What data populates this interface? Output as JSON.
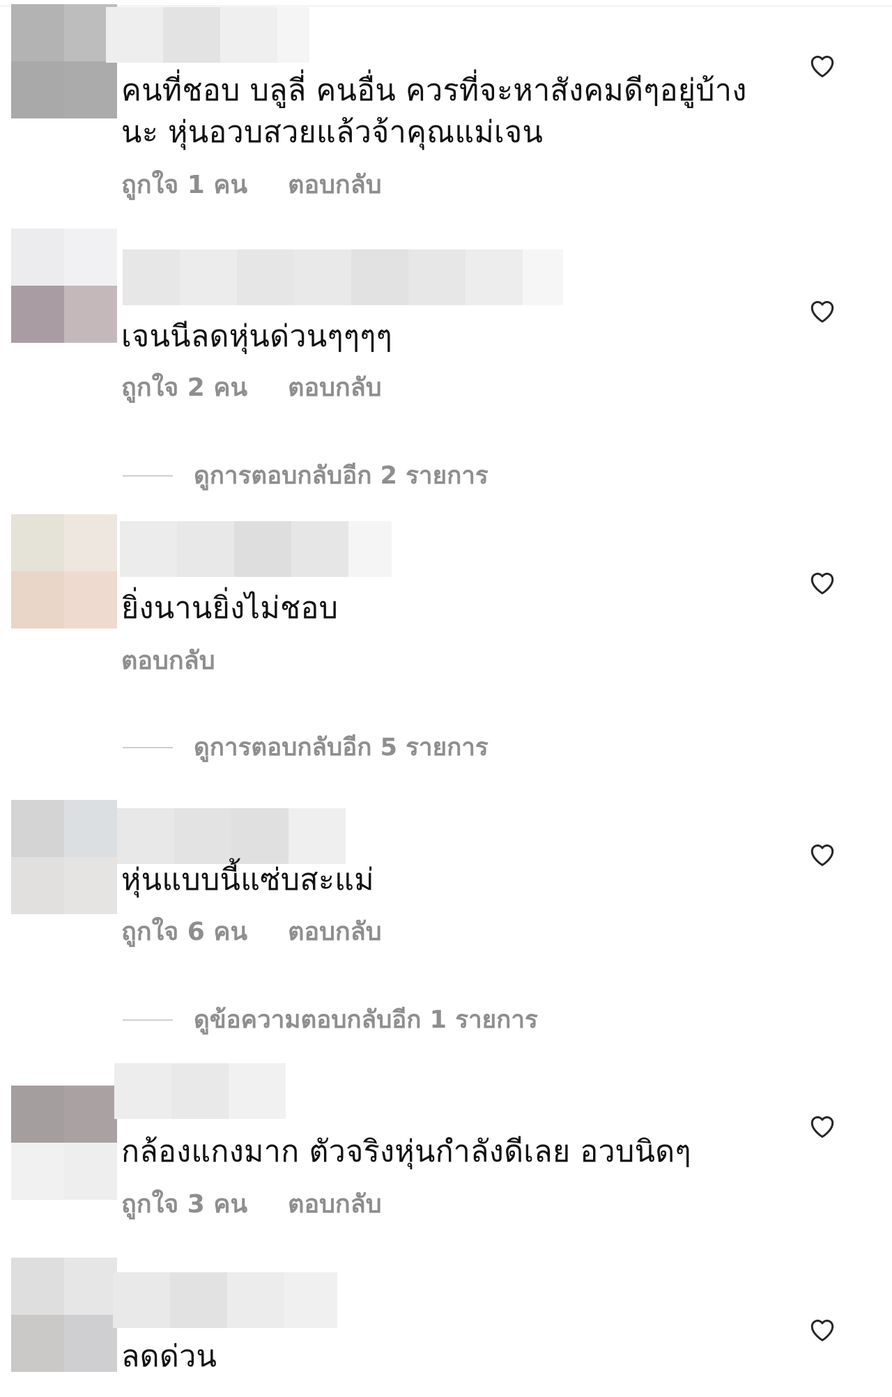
{
  "comments": [
    {
      "text": "คนที่ชอบ บลูลี่ คนอื่น ควรที่จะหาสังคมดีๆอยู่บ้าง\nนะ หุ่นอวบสวยแล้วจ้าคุณแม่เจน",
      "likes": "ถูกใจ 1 คน",
      "reply": "ตอบกลับ",
      "avatar_colors": [
        "#b3b3b3",
        "#bdbdbd",
        "#a9a9a9",
        "#ababab"
      ],
      "name_colors": [
        "#eeeeee",
        "#e3e3e3",
        "#efefef",
        "#f5f5f5"
      ]
    },
    {
      "text": "เจนนีลดหุ่นด่วนๆๆๆๆ",
      "likes": "ถูกใจ 2 คน",
      "reply": "ตอบกลับ",
      "avatar_colors": [
        "#ececee",
        "#f1f1f3",
        "#a99da3",
        "#c5b8bb"
      ],
      "name_colors": [
        "#e7e7e7",
        "#ececec",
        "#e6e6e6",
        "#e9e9e9",
        "#e2e2e2",
        "#e7e7e7",
        "#ededed",
        "#f6f6f6"
      ],
      "view_more": "ดูการตอบกลับอีก 2 รายการ"
    },
    {
      "text": "ยิ่งนานยิ่งไม่ชอบ",
      "likes": "",
      "reply": "ตอบกลับ",
      "avatar_colors": [
        "#e5e2d8",
        "#ede7df",
        "#e9d6c8",
        "#efdad0"
      ],
      "name_colors": [
        "#ececec",
        "#e8e8e8",
        "#dedede",
        "#e6e6e6",
        "#f5f5f5"
      ],
      "view_more": "ดูการตอบกลับอีก 5 รายการ"
    },
    {
      "text": "หุ่นแบบนี้แซ่บสะแม่",
      "likes": "ถูกใจ 6 คน",
      "reply": "ตอบกลับ",
      "avatar_colors": [
        "#d4d4d4",
        "#dcdfe1",
        "#e2e0df",
        "#e6e4e3"
      ],
      "name_colors": [
        "#e8e8e8",
        "#e3e3e3",
        "#e0e0e0",
        "#efefef"
      ],
      "view_more": "ดูข้อความตอบกลับอีก 1 รายการ"
    },
    {
      "text": "กล้องแกงมาก ตัวจริงหุ่นกำลังดีเลย อวบนิดๆ",
      "likes": "ถูกใจ 3 คน",
      "reply": "ตอบกลับ",
      "avatar_colors": [
        "#a59e9e",
        "#aaa2a2",
        "#f1f1f1",
        "#efeeee"
      ],
      "name_colors": [
        "#ededed",
        "#e9e9e9",
        "#f1f1f1"
      ]
    },
    {
      "text": "ลดด่วน",
      "likes": "",
      "reply": "",
      "avatar_colors": [
        "#dedede",
        "#e6e6e6",
        "#cbc9c8",
        "#cfcfd2"
      ],
      "name_colors": [
        "#e9e9e9",
        "#e2e2e2",
        "#ececec",
        "#f0f0f0"
      ]
    }
  ]
}
